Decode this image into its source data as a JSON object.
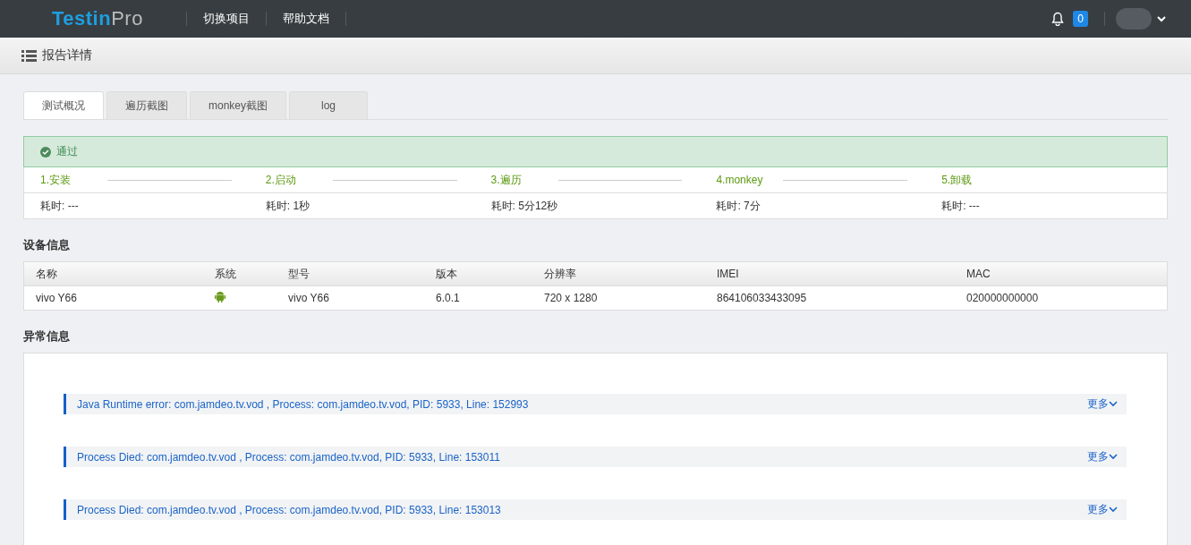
{
  "topbar": {
    "logo": {
      "main": "Testin",
      "suffix": "Pro"
    },
    "nav": [
      "切换项目",
      "帮助文档"
    ],
    "notification_count": "0"
  },
  "page_header": {
    "title": "报告详情"
  },
  "tabs": [
    {
      "label": "测试概况",
      "selected": true
    },
    {
      "label": "遍历截图",
      "selected": false
    },
    {
      "label": "monkey截图",
      "selected": false
    },
    {
      "label": "log",
      "selected": false
    }
  ],
  "result": {
    "status": "通过",
    "passed": true
  },
  "steps": [
    {
      "label": "1.安装",
      "duration": "耗时: ---"
    },
    {
      "label": "2.启动",
      "duration": "耗时: 1秒"
    },
    {
      "label": "3.遍历",
      "duration": "耗时: 5分12秒"
    },
    {
      "label": "4.monkey",
      "duration": "耗时: 7分"
    },
    {
      "label": "5.卸载",
      "duration": "耗时: ---"
    }
  ],
  "device_section": {
    "title": "设备信息"
  },
  "device_table": {
    "columns": [
      "名称",
      "系统",
      "型号",
      "版本",
      "分辨率",
      "IMEI",
      "MAC"
    ],
    "rows": [
      {
        "cells": [
          {
            "kind": "text",
            "text": "vivo Y66"
          },
          {
            "kind": "android"
          },
          {
            "kind": "text",
            "text": "vivo Y66"
          },
          {
            "kind": "text",
            "text": "6.0.1"
          },
          {
            "kind": "text",
            "text": "720 x 1280"
          },
          {
            "kind": "text",
            "text": "864106033433095"
          },
          {
            "kind": "text",
            "text": "020000000000"
          }
        ]
      }
    ]
  },
  "exception_section": {
    "title": "异常信息"
  },
  "exceptions": [
    {
      "text": "Java Runtime error: com.jamdeo.tv.vod , Process: com.jamdeo.tv.vod, PID: 5933, Line: 152993",
      "more": "更多"
    },
    {
      "text": "Process Died: com.jamdeo.tv.vod , Process: com.jamdeo.tv.vod, PID: 5933, Line: 153011",
      "more": "更多"
    },
    {
      "text": "Process Died: com.jamdeo.tv.vod , Process: com.jamdeo.tv.vod, PID: 5933, Line: 153013",
      "more": "更多"
    }
  ]
}
